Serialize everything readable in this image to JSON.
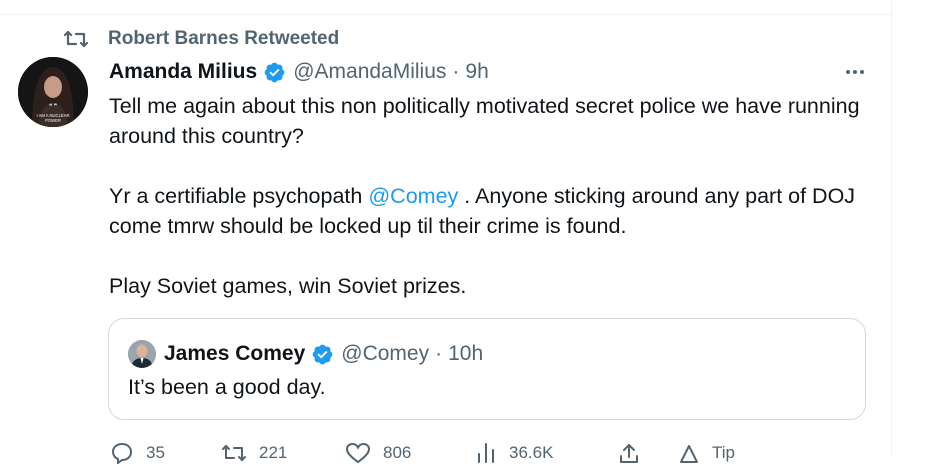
{
  "retweet_banner": {
    "text": "Robert Barnes Retweeted"
  },
  "tweet": {
    "author_name": "Amanda Milius",
    "handle": "@AmandaMilius",
    "separator": "·",
    "time": "9h",
    "avatar_caption_line1": "I AM A NUCLEAR",
    "avatar_caption_line2": "POWER",
    "paragraph1": "Tell me again about this non politically motivated secret police we have running around this country?",
    "paragraph2_before": "Yr a certifiable psychopath ",
    "paragraph2_mention": "@Comey",
    "paragraph2_after": " . Anyone sticking around any part of DOJ come tmrw should be locked up til their crime is found.",
    "paragraph3": "Play Soviet games, win Soviet prizes."
  },
  "quoted_tweet": {
    "author_name": "James Comey",
    "handle": "@Comey",
    "separator": "·",
    "time": "10h",
    "text": "It’s been a good day."
  },
  "actions": {
    "replies": "35",
    "retweets": "221",
    "likes": "806",
    "views": "36.6K",
    "tip_label": "Tip"
  },
  "colors": {
    "accent": "#1d9bf0",
    "secondary_text": "#536471",
    "border": "#cfd9de"
  }
}
